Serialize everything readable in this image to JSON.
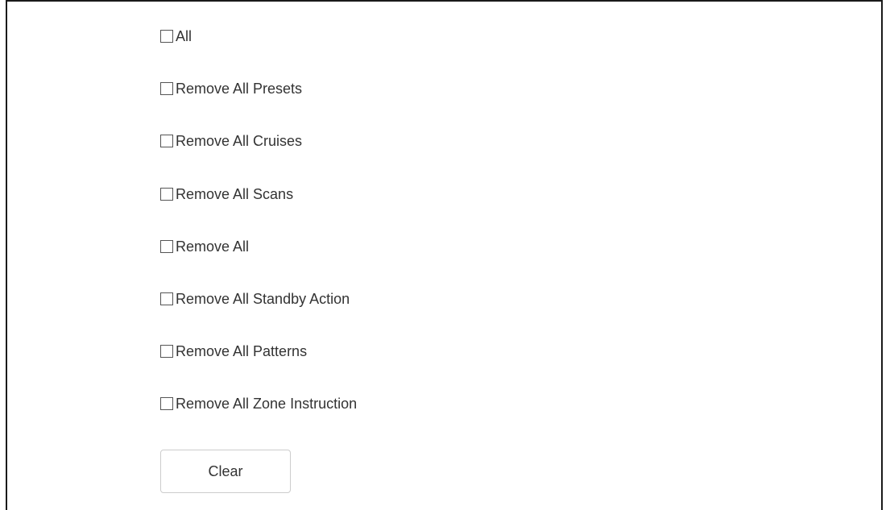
{
  "options": [
    {
      "label": "All",
      "checked": false
    },
    {
      "label": "Remove All Presets",
      "checked": false
    },
    {
      "label": "Remove All Cruises",
      "checked": false
    },
    {
      "label": "Remove All Scans",
      "checked": false
    },
    {
      "label": "Remove All",
      "checked": false
    },
    {
      "label": "Remove All Standby Action",
      "checked": false
    },
    {
      "label": "Remove All Patterns",
      "checked": false
    },
    {
      "label": "Remove All Zone Instruction",
      "checked": false
    }
  ],
  "actions": {
    "clear_label": "Clear"
  }
}
